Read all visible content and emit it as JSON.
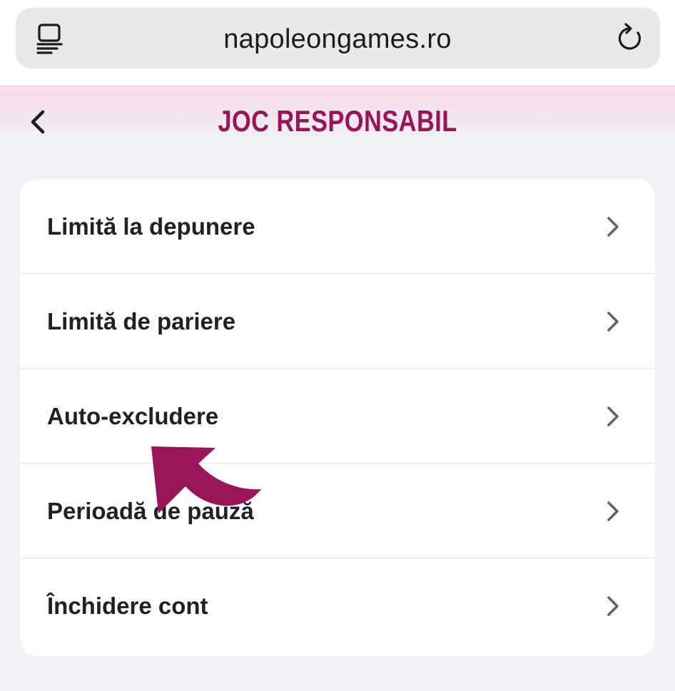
{
  "browser": {
    "url": "napoleongames.ro",
    "tabs_icon": "tabs-icon",
    "reload_icon": "reload-icon"
  },
  "header": {
    "title": "JOC RESPONSABIL",
    "back_icon": "chevron-left-icon"
  },
  "menu": {
    "items": [
      {
        "label": "Limită la depunere",
        "icon": "chevron-right-icon"
      },
      {
        "label": "Limită de pariere",
        "icon": "chevron-right-icon"
      },
      {
        "label": "Auto-excludere",
        "icon": "chevron-right-icon"
      },
      {
        "label": "Perioadă de pauză",
        "icon": "chevron-right-icon"
      },
      {
        "label": "Închidere cont",
        "icon": "chevron-right-icon"
      }
    ]
  },
  "annotation": {
    "icon": "curved-arrow-icon",
    "color": "#9a1458"
  },
  "colors": {
    "accent": "#9a1458",
    "background": "#f1f2f5",
    "card": "#ffffff",
    "text": "#1f2126",
    "chevron": "#5f6470"
  }
}
